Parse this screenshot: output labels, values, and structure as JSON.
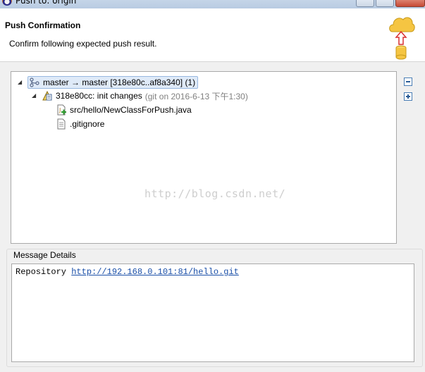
{
  "window": {
    "title": "Push to: origin"
  },
  "banner": {
    "heading": "Push Confirmation",
    "subtext": "Confirm following expected push result."
  },
  "tree": {
    "root": {
      "label": "master → master [318e80c..af8a340] (1)",
      "icon": "branch-icon",
      "expanded": true,
      "selected": true
    },
    "commit": {
      "label": "318e80cc: init changes",
      "meta": "(git on 2016-6-13 下午1:30)",
      "icon": "commit-icon",
      "expanded": true
    },
    "files": [
      {
        "label": "src/hello/NewClassForPush.java",
        "icon": "java-file-added-icon"
      },
      {
        "label": ".gitignore",
        "icon": "text-file-icon"
      }
    ]
  },
  "toolbar": {
    "collapse_all": "collapse-all-icon",
    "expand_all": "expand-all-icon"
  },
  "watermark": "http://blog.csdn.net/",
  "details": {
    "group_label": "Message Details",
    "prefix": "Repository",
    "link": "http://192.168.0.101:81/hello.git"
  },
  "colors": {
    "selection_bg": "#dfeaf8",
    "link": "#1a4fa8",
    "cloud": "#f5c542",
    "arrow": "#d93030"
  }
}
